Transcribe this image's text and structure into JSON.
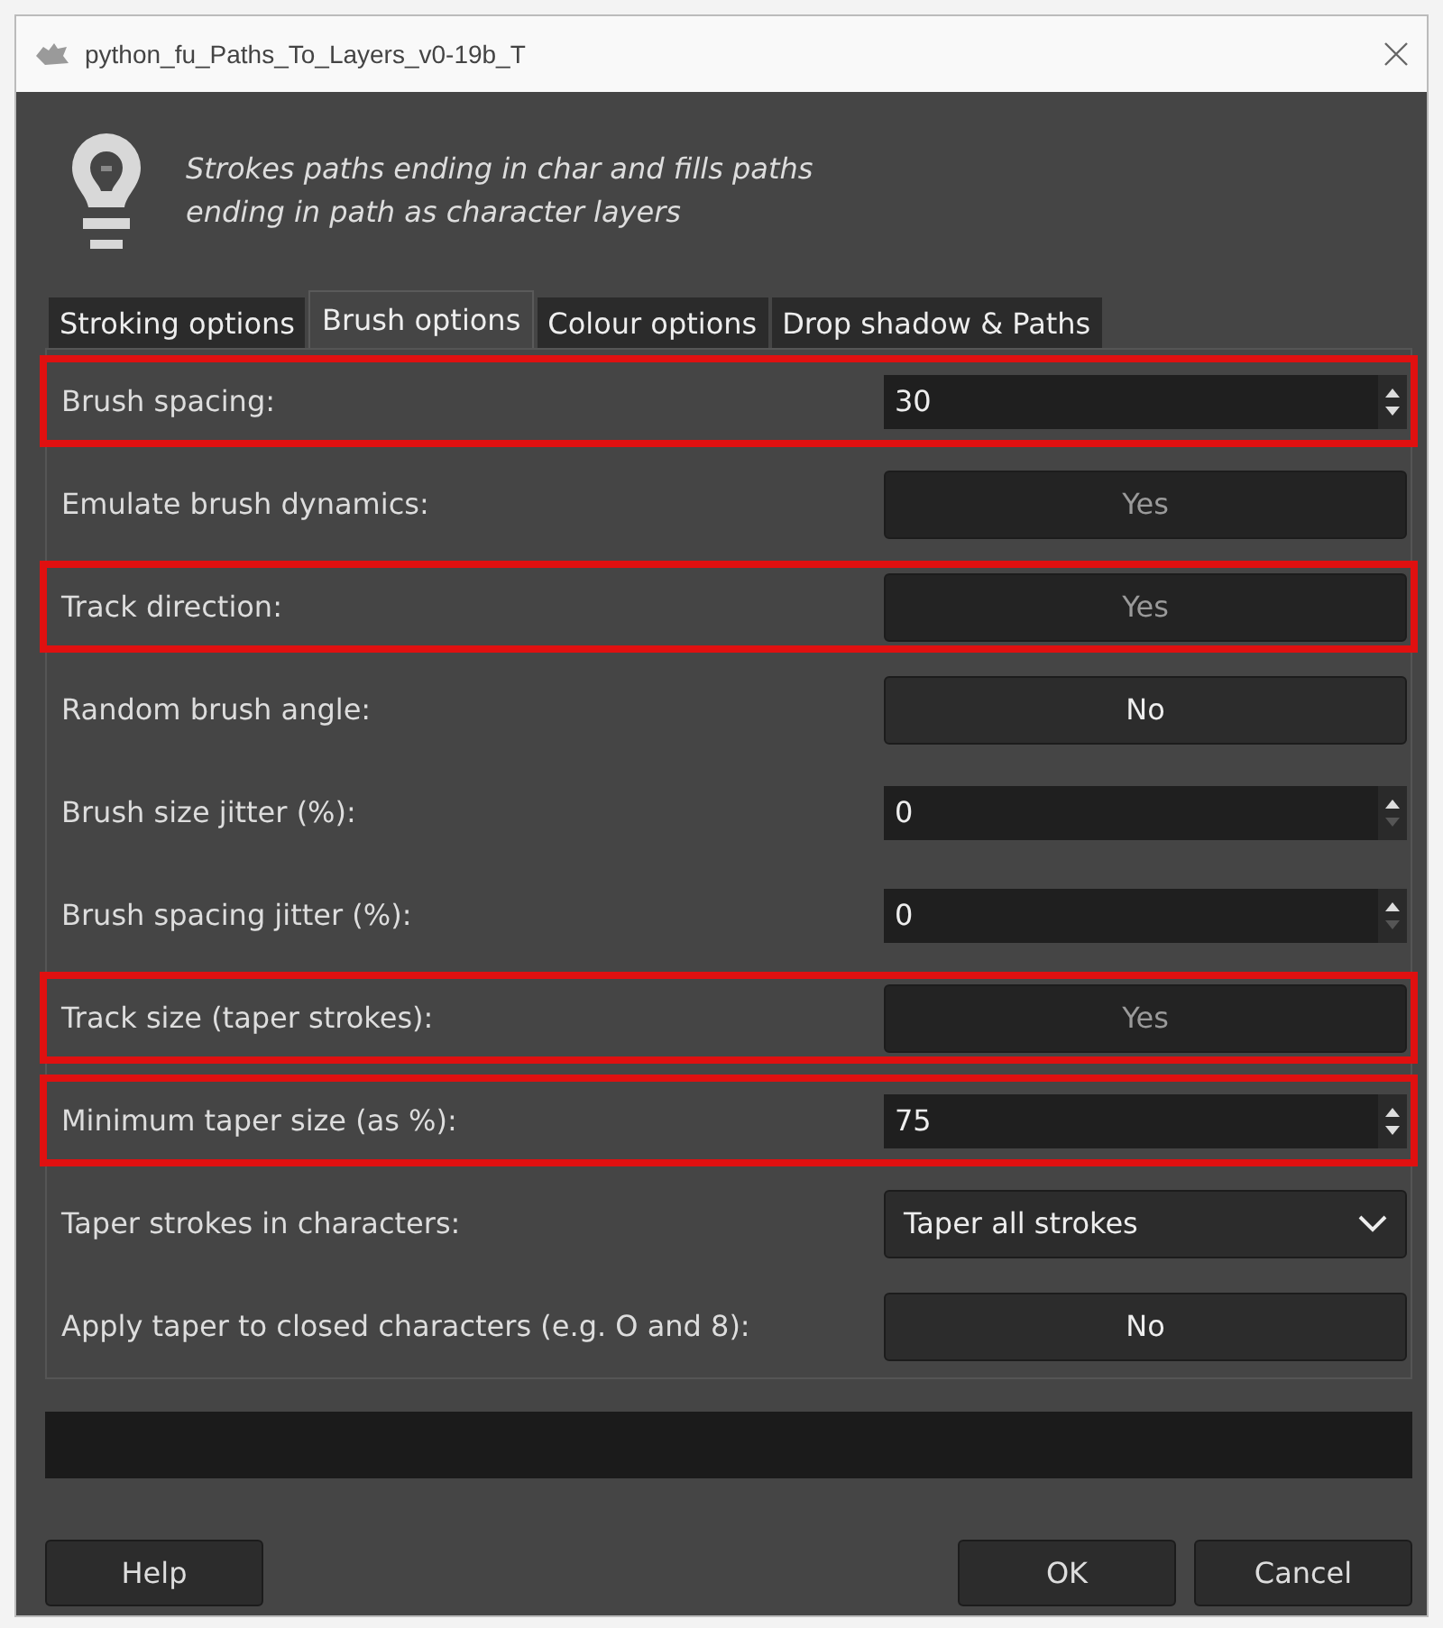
{
  "window": {
    "title": "python_fu_Paths_To_Layers_v0-19b_T"
  },
  "description": "Strokes paths ending in char and fills paths\nending in path as character layers",
  "tabs": [
    {
      "label": "Stroking options",
      "selected": false
    },
    {
      "label": "Brush options",
      "selected": true
    },
    {
      "label": "Colour options",
      "selected": false
    },
    {
      "label": "Drop shadow & Paths",
      "selected": false
    }
  ],
  "rows": [
    {
      "label": "Brush spacing:",
      "kind": "spin",
      "value": "30",
      "down_disabled": false,
      "highlighted": true
    },
    {
      "label": "Emulate brush dynamics:",
      "kind": "toggle",
      "value": "Yes",
      "on": true,
      "highlighted": false
    },
    {
      "label": "Track direction:",
      "kind": "toggle",
      "value": "Yes",
      "on": true,
      "highlighted": true
    },
    {
      "label": "Random brush angle:",
      "kind": "toggle",
      "value": "No",
      "on": false,
      "highlighted": false
    },
    {
      "label": "Brush size jitter (%):",
      "kind": "spin",
      "value": "0",
      "down_disabled": true,
      "highlighted": false
    },
    {
      "label": "Brush spacing jitter (%):",
      "kind": "spin",
      "value": "0",
      "down_disabled": true,
      "highlighted": false
    },
    {
      "label": "Track size (taper strokes):",
      "kind": "toggle",
      "value": "Yes",
      "on": true,
      "highlighted": true
    },
    {
      "label": "Minimum taper size (as %):",
      "kind": "spin",
      "value": "75",
      "down_disabled": false,
      "highlighted": true
    },
    {
      "label": "Taper strokes in characters:",
      "kind": "dropdown",
      "value": "Taper all strokes",
      "highlighted": false
    },
    {
      "label": "Apply taper to closed characters (e.g. O and 8):",
      "kind": "toggle",
      "value": "No",
      "on": false,
      "highlighted": false
    }
  ],
  "progress": {
    "level": 0
  },
  "buttons": {
    "left": [
      "Help"
    ],
    "right": [
      "OK",
      "Cancel"
    ]
  }
}
